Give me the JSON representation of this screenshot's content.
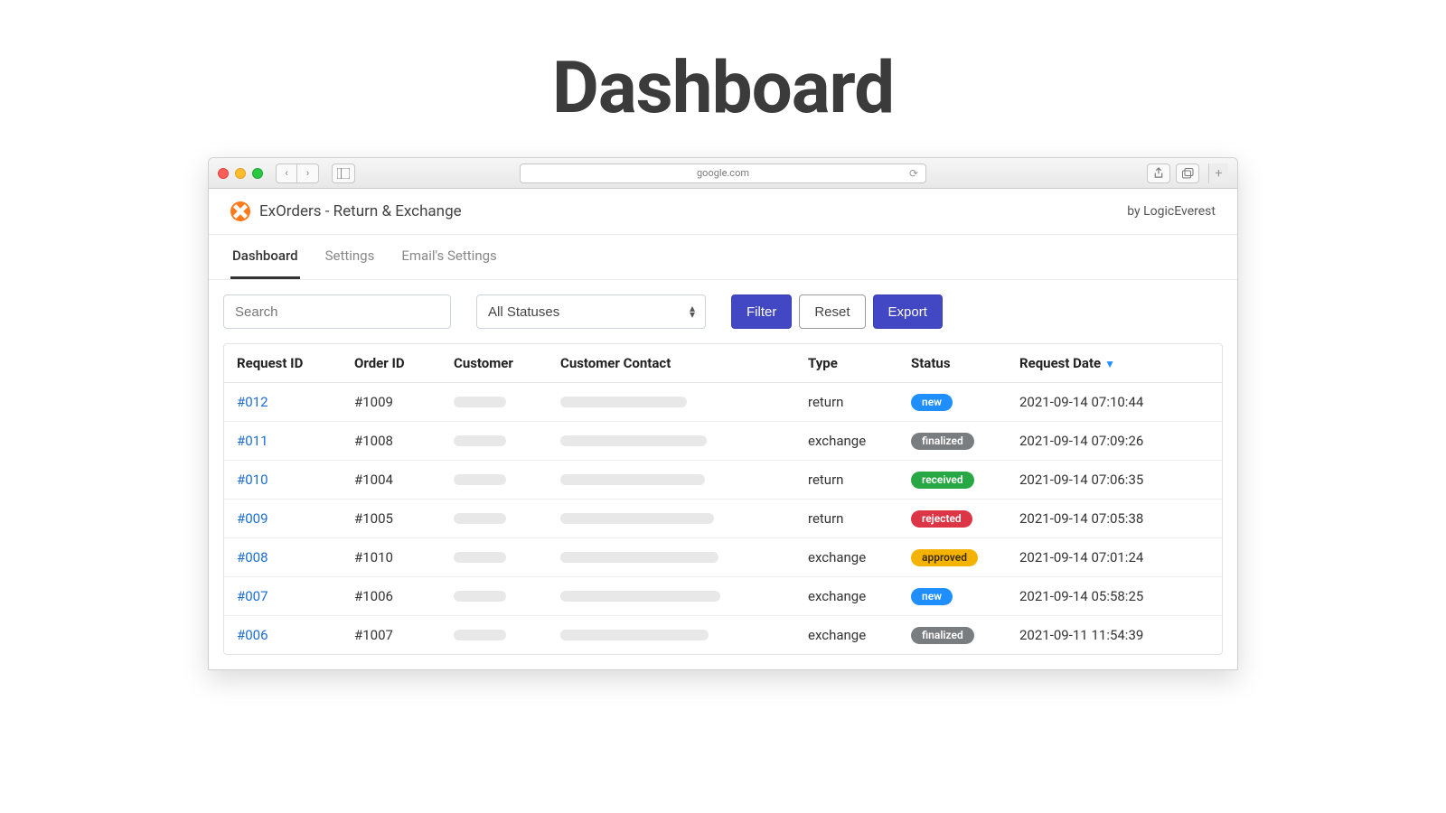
{
  "page_heading": "Dashboard",
  "browser": {
    "url": "google.com"
  },
  "app": {
    "title": "ExOrders - Return & Exchange",
    "byline": "by LogicEverest"
  },
  "tabs": [
    {
      "label": "Dashboard",
      "active": true
    },
    {
      "label": "Settings",
      "active": false
    },
    {
      "label": "Email's Settings",
      "active": false
    }
  ],
  "toolbar": {
    "search_placeholder": "Search",
    "status_filter": "All Statuses",
    "filter_label": "Filter",
    "reset_label": "Reset",
    "export_label": "Export"
  },
  "table": {
    "headers": {
      "request_id": "Request ID",
      "order_id": "Order ID",
      "customer": "Customer",
      "contact": "Customer Contact",
      "type": "Type",
      "status": "Status",
      "date": "Request Date"
    },
    "sort_column": "date",
    "sort_dir": "desc",
    "rows": [
      {
        "request_id": "#012",
        "order_id": "#1009",
        "customer_w": 58,
        "contact_w": 140,
        "type": "return",
        "status": "new",
        "date": "2021-09-14 07:10:44"
      },
      {
        "request_id": "#011",
        "order_id": "#1008",
        "customer_w": 58,
        "contact_w": 162,
        "type": "exchange",
        "status": "finalized",
        "date": "2021-09-14 07:09:26"
      },
      {
        "request_id": "#010",
        "order_id": "#1004",
        "customer_w": 58,
        "contact_w": 160,
        "type": "return",
        "status": "received",
        "date": "2021-09-14 07:06:35"
      },
      {
        "request_id": "#009",
        "order_id": "#1005",
        "customer_w": 58,
        "contact_w": 170,
        "type": "return",
        "status": "rejected",
        "date": "2021-09-14 07:05:38"
      },
      {
        "request_id": "#008",
        "order_id": "#1010",
        "customer_w": 58,
        "contact_w": 175,
        "type": "exchange",
        "status": "approved",
        "date": "2021-09-14 07:01:24"
      },
      {
        "request_id": "#007",
        "order_id": "#1006",
        "customer_w": 58,
        "contact_w": 177,
        "type": "exchange",
        "status": "new",
        "date": "2021-09-14 05:58:25"
      },
      {
        "request_id": "#006",
        "order_id": "#1007",
        "customer_w": 58,
        "contact_w": 164,
        "type": "exchange",
        "status": "finalized",
        "date": "2021-09-11 11:54:39"
      }
    ]
  },
  "status_colors": {
    "new": "b-new",
    "finalized": "b-finalized",
    "received": "b-received",
    "rejected": "b-rejected",
    "approved": "b-approved"
  }
}
